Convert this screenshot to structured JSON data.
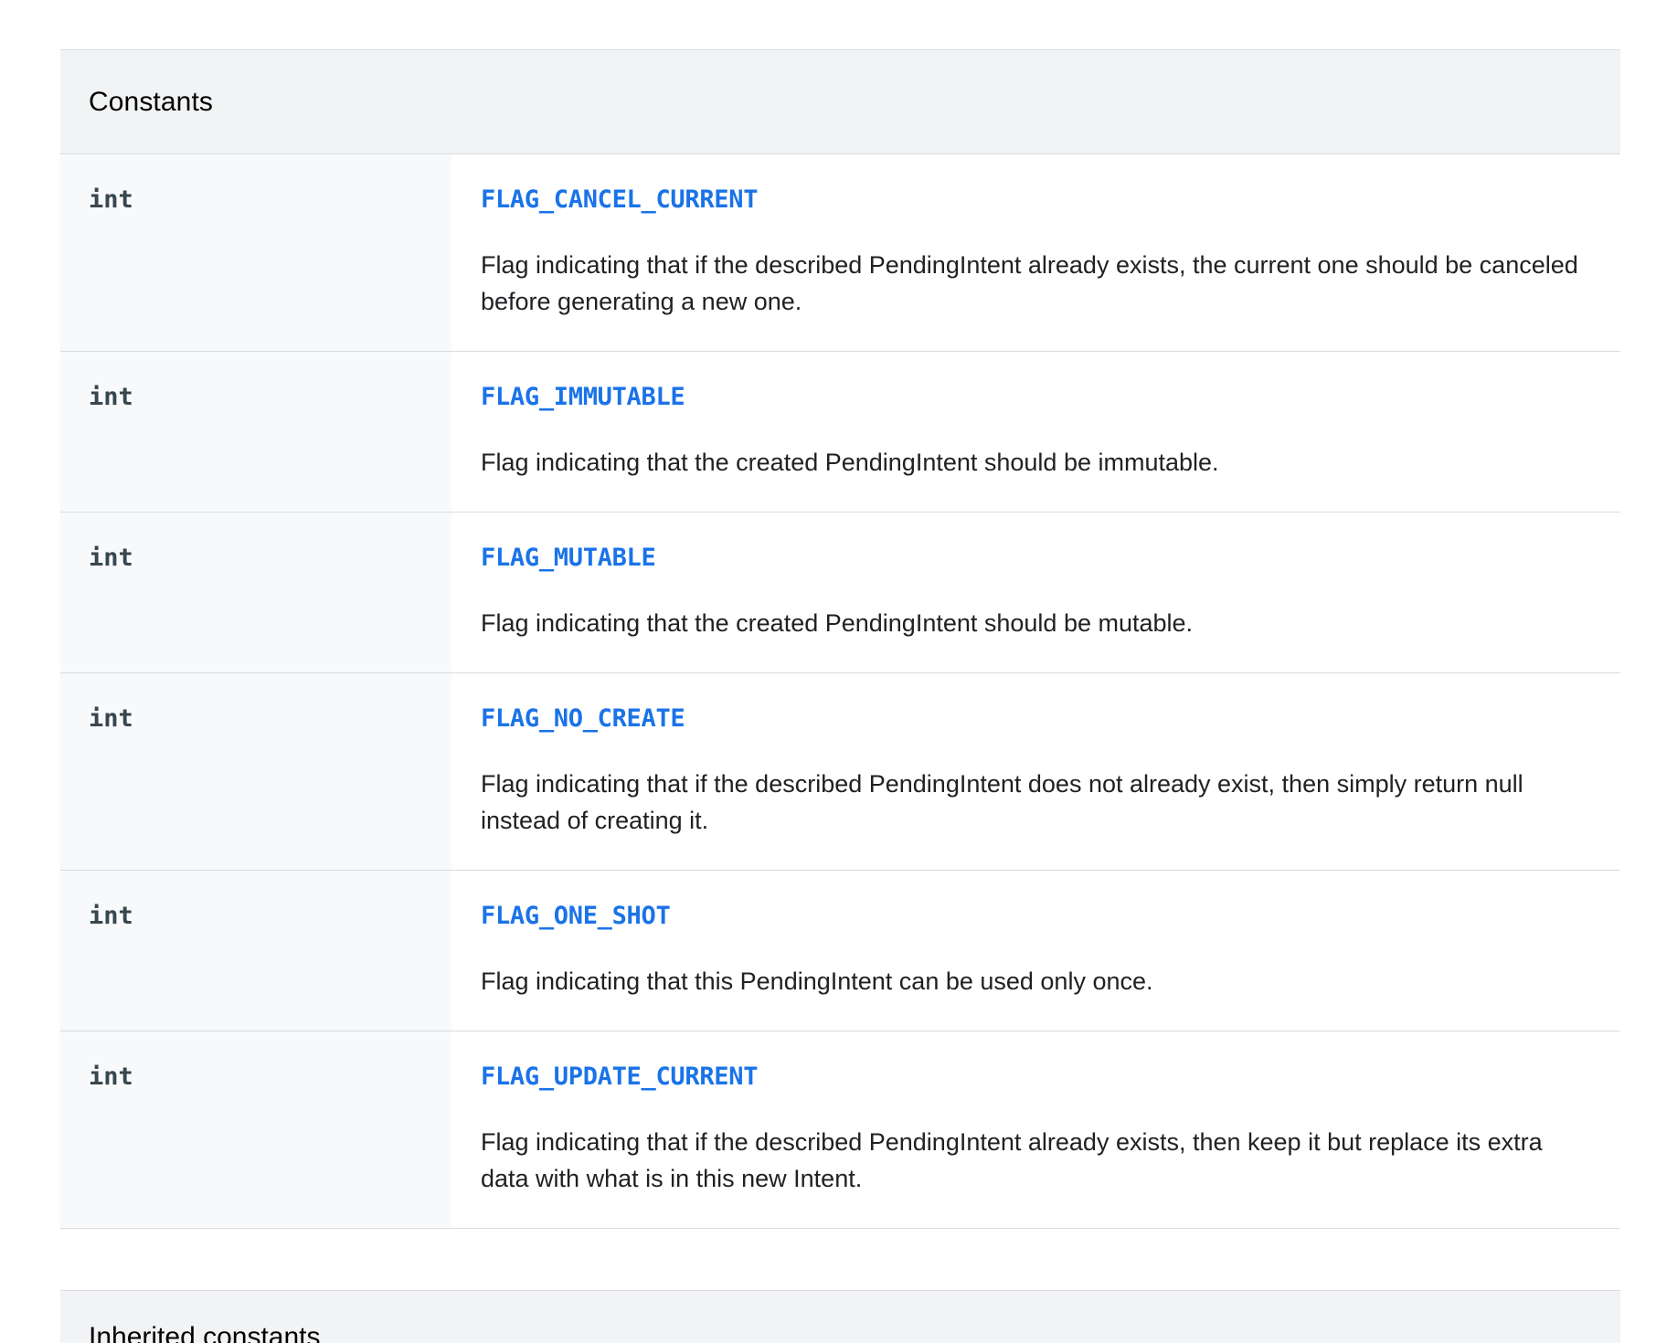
{
  "constants_table": {
    "title": "Constants",
    "rows": [
      {
        "type": "int",
        "name": "FLAG_CANCEL_CURRENT",
        "description": "Flag indicating that if the described PendingIntent already exists, the current one should be canceled before generating a new one."
      },
      {
        "type": "int",
        "name": "FLAG_IMMUTABLE",
        "description": "Flag indicating that the created PendingIntent should be immutable."
      },
      {
        "type": "int",
        "name": "FLAG_MUTABLE",
        "description": "Flag indicating that the created PendingIntent should be mutable."
      },
      {
        "type": "int",
        "name": "FLAG_NO_CREATE",
        "description": "Flag indicating that if the described PendingIntent does not already exist, then simply return null instead of creating it."
      },
      {
        "type": "int",
        "name": "FLAG_ONE_SHOT",
        "description": "Flag indicating that this PendingIntent can be used only once."
      },
      {
        "type": "int",
        "name": "FLAG_UPDATE_CURRENT",
        "description": "Flag indicating that if the described PendingIntent already exists, then keep it but replace its extra data with what is in this new Intent."
      }
    ]
  },
  "inherited_table": {
    "title": "Inherited constants"
  },
  "colors": {
    "link": "#1a73e8",
    "header_bg": "#f1f3f4",
    "type_col_bg": "#f8f9fa",
    "border": "#dadce0"
  }
}
